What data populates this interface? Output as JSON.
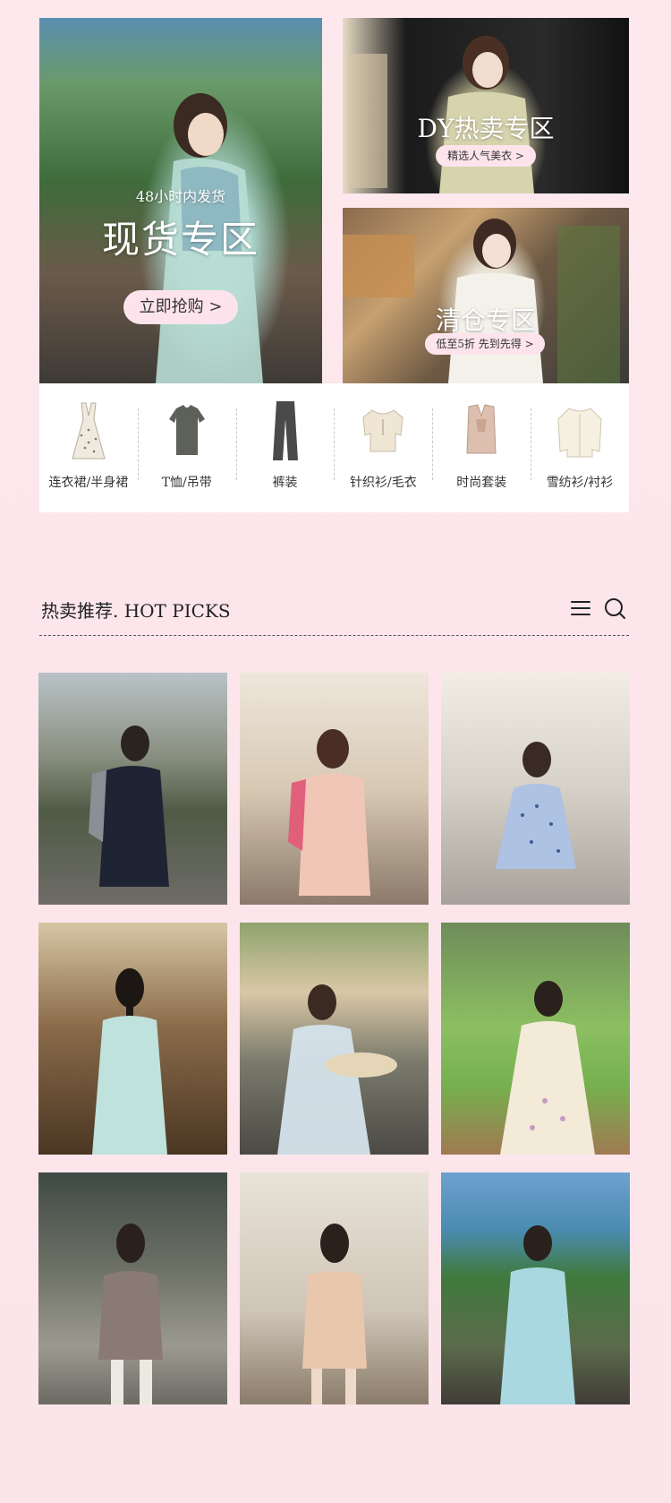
{
  "banners": {
    "left": {
      "subtitle": "48小时内发货",
      "title": "现货专区",
      "button": "立即抢购 >"
    },
    "right_top": {
      "title": "DY热卖专区",
      "button": "精选人气美衣 >"
    },
    "right_bottom": {
      "title": "清仓专区",
      "button": "低至5折 先到先得 >"
    }
  },
  "categories": [
    {
      "label": "连衣裙/半身裙",
      "icon": "dress-icon"
    },
    {
      "label": "T恤/吊带",
      "icon": "tshirt-icon"
    },
    {
      "label": "裤装",
      "icon": "pants-icon"
    },
    {
      "label": "针织衫/毛衣",
      "icon": "knit-top-icon"
    },
    {
      "label": "时尚套装",
      "icon": "outfit-set-icon"
    },
    {
      "label": "雪纺衫/衬衫",
      "icon": "blouse-icon"
    }
  ],
  "section": {
    "title": "热卖推荐. HOT PICKS",
    "menu_icon": "menu-icon",
    "search_icon": "search-icon"
  },
  "colors": {
    "background": "#fce6ec",
    "button_pink": "#fde4ec"
  },
  "products": [
    {
      "id": "p1"
    },
    {
      "id": "p2"
    },
    {
      "id": "p3"
    },
    {
      "id": "p4"
    },
    {
      "id": "p5"
    },
    {
      "id": "p6"
    },
    {
      "id": "p7"
    },
    {
      "id": "p8"
    },
    {
      "id": "p9"
    }
  ]
}
